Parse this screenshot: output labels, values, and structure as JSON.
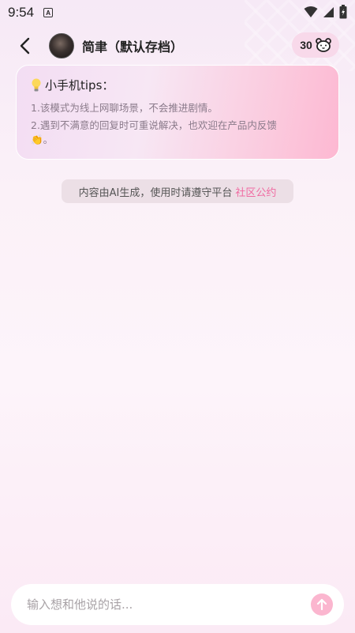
{
  "status_bar": {
    "time": "9:54",
    "notification_letter": "A"
  },
  "header": {
    "character_name": "简聿（默认存档）",
    "points": "30"
  },
  "tips": {
    "title": "小手机tips：",
    "line1": "1.该模式为线上网聊场景，不会推进剧情。",
    "line2": "2.遇到不满意的回复时可重说解决，也欢迎在产品内反馈",
    "line3": "👏。"
  },
  "notice": {
    "text": "内容由AI生成，使用时请遵守平台",
    "link": "社区公约"
  },
  "composer": {
    "placeholder": "输入想和他说的话..."
  },
  "colors": {
    "accent": "#f06aa1",
    "send_button": "#fbb6cf",
    "badge_bg": "#f8d9ea"
  }
}
